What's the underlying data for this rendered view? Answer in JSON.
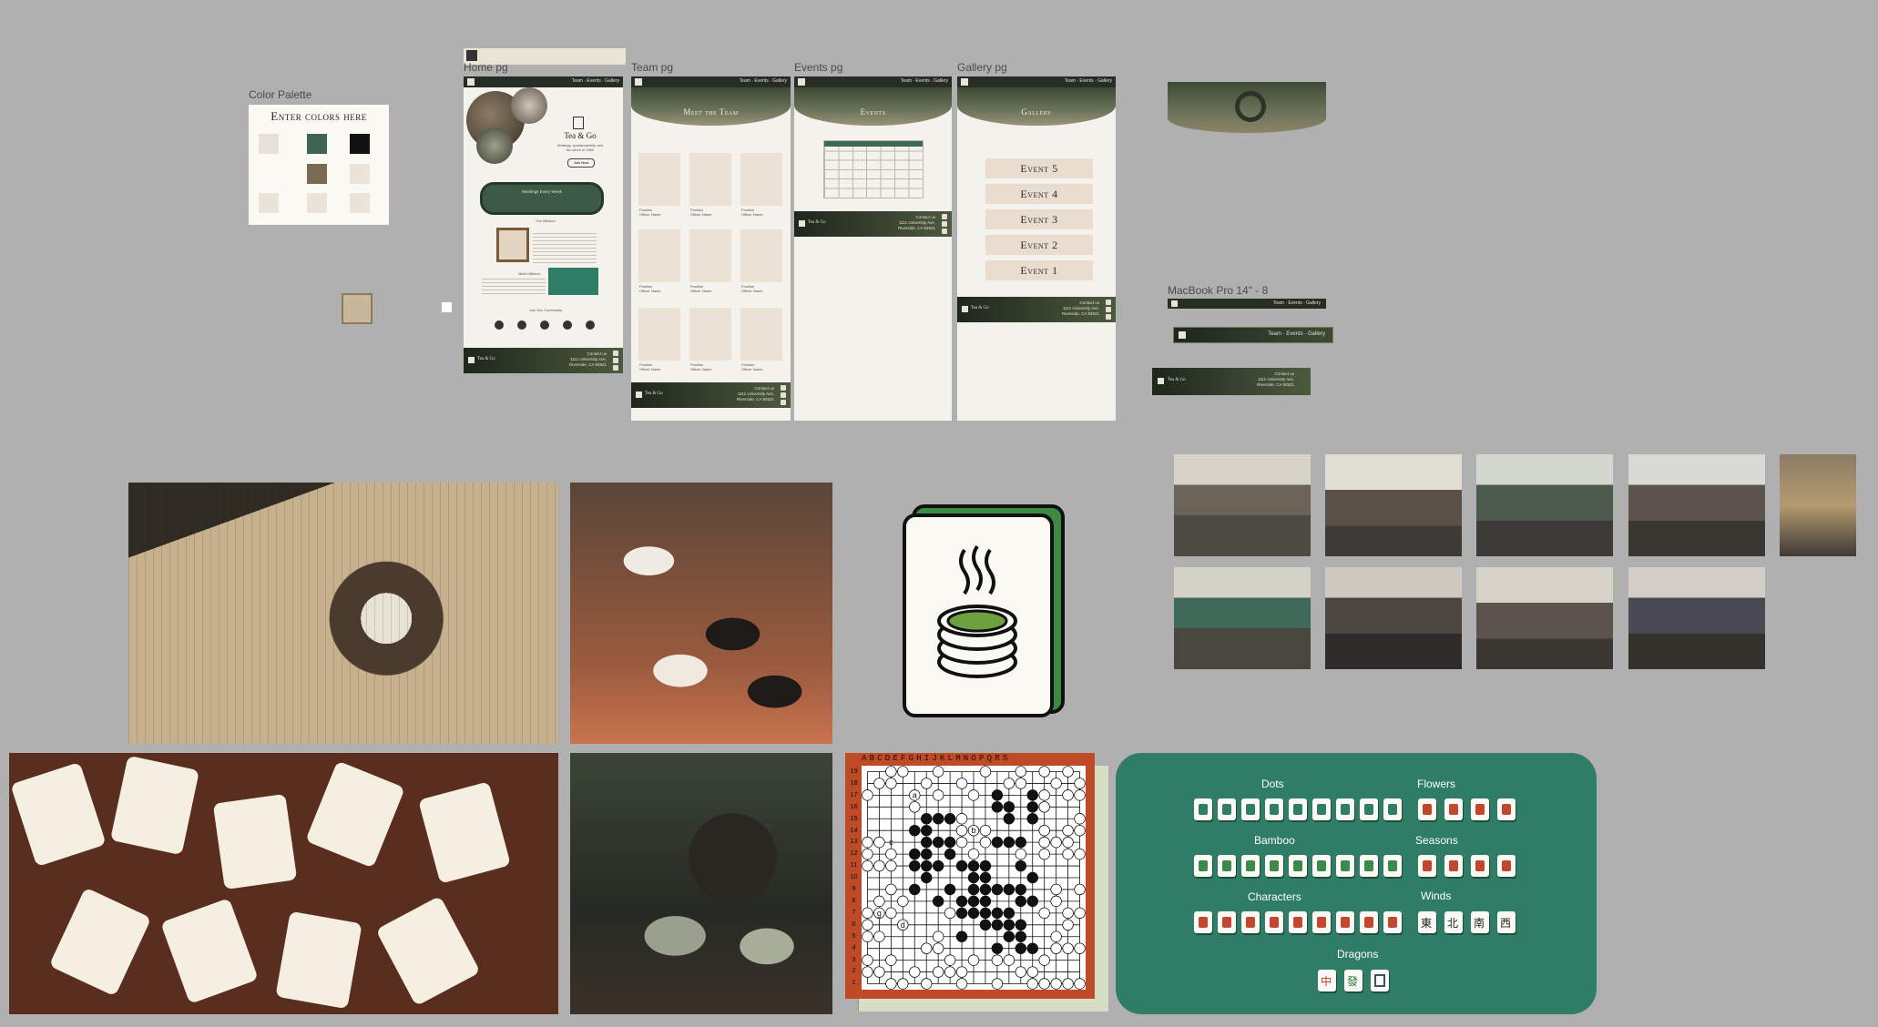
{
  "frames": {
    "color_palette": "Color Palette",
    "home": "Home pg",
    "team": "Team pg",
    "events": "Events pg",
    "gallery": "Gallery pg",
    "macbook": "MacBook Pro 14\" - 8"
  },
  "palette": {
    "title": "Enter colors here",
    "swatches": [
      "#e9e1d8",
      "#3f6451",
      "#121212",
      "#7a6b52",
      "#ece4da",
      "#ece4da",
      "#ece4da",
      "#ece4da",
      "#ece4da"
    ]
  },
  "site": {
    "name": "Tea & Go",
    "nav": [
      "Team",
      "Events",
      "Gallery"
    ],
    "contact_lines": [
      "Contact us",
      "1111 University Ave,",
      "Riverside, CA 92521"
    ],
    "home": {
      "hero_title": "Tea & Go",
      "tagline_1": "Strategy, sportsmanship and",
      "tagline_2": "fun since in 1984",
      "join_button": "Join Now",
      "banner": "Meetings Every Week",
      "section_1": "Our Mission",
      "section_2": "Meet Officers",
      "section_3": "Join Our Community"
    },
    "team": {
      "title": "Meet the Team",
      "caption_lines": [
        "Position",
        "Officer Name"
      ]
    },
    "events": {
      "title": "Events"
    },
    "gallery": {
      "title": "Gallery",
      "events": [
        "Event 5",
        "Event 4",
        "Event 3",
        "Event 2",
        "Event 1"
      ]
    }
  },
  "go_board": {
    "columns": "ABCDEFGHIJKLMNOPQRS",
    "rows": [
      "19",
      "18",
      "17",
      "16",
      "15",
      "14",
      "13",
      "12",
      "11",
      "10",
      "9",
      "8",
      "7",
      "6",
      "5",
      "4",
      "3",
      "2",
      "1"
    ],
    "annotations": [
      "a",
      "b",
      "c",
      "d",
      "e",
      "f",
      "g"
    ]
  },
  "tiles_panel": {
    "groups": [
      "Dots",
      "Flowers",
      "Bamboo",
      "Seasons",
      "Characters",
      "Winds",
      "Dragons"
    ],
    "winds": [
      "東",
      "北",
      "南",
      "西"
    ],
    "dragons": [
      "中",
      "發"
    ],
    "colors": {
      "panel": "#2f7d66",
      "tile": "#fbf9f3"
    }
  },
  "colors": {
    "canvas": "#b0b0b0",
    "dark_green": "#262d24",
    "accent_green": "#2f7d66",
    "cream": "#f4f2ec"
  }
}
